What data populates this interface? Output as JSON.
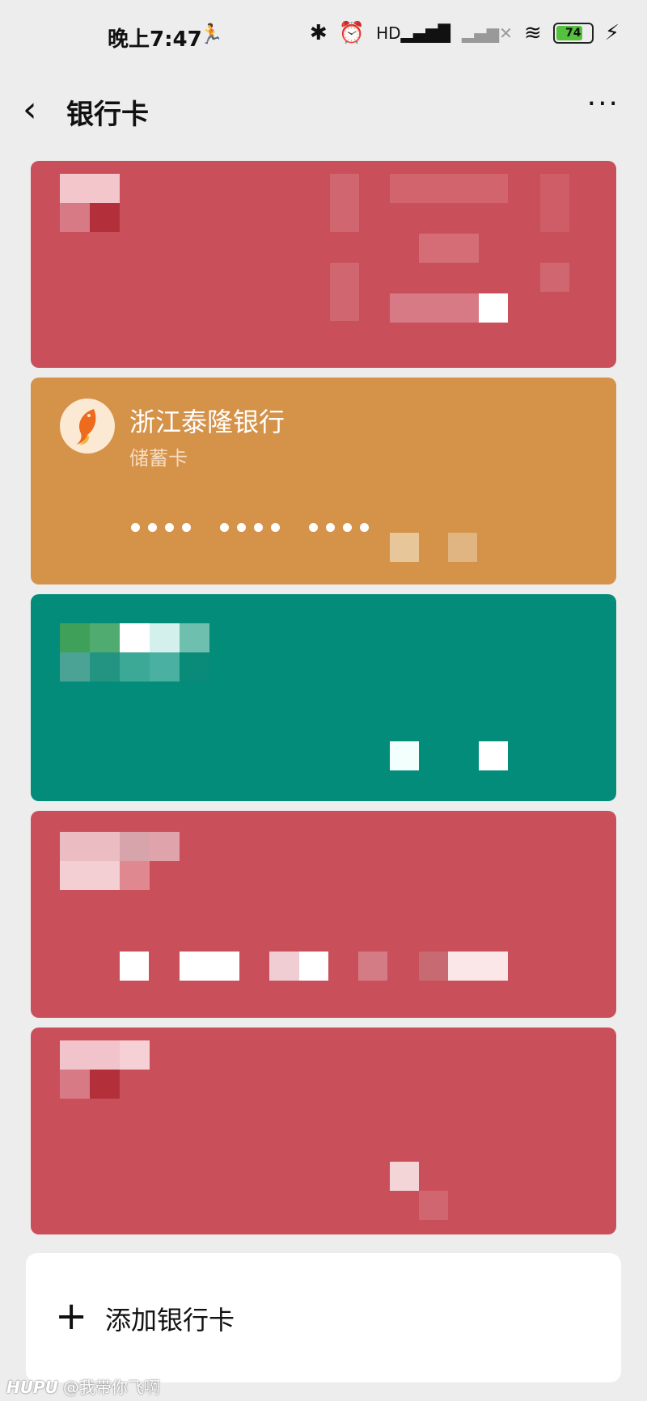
{
  "statusbar": {
    "time": "晚上7:47",
    "battery": "74",
    "icons": [
      "running-icon",
      "bluetooth-icon",
      "alarm-icon",
      "signal-hd-icon",
      "signal-2-icon",
      "wifi-icon",
      "battery-icon",
      "charging-icon"
    ]
  },
  "navbar": {
    "title": "银行卡",
    "more": "···"
  },
  "cards": [
    {
      "color": "#c9505a",
      "obscured": true
    },
    {
      "color": "#d59249",
      "bank_name": "浙江泰隆银行",
      "card_type": "储蓄卡"
    },
    {
      "color": "#028c79",
      "obscured": true
    },
    {
      "color": "#c9505a",
      "obscured": true
    },
    {
      "color": "#c9505a",
      "obscured": true
    }
  ],
  "add": {
    "plus": "+",
    "label": "添加银行卡"
  },
  "watermark": {
    "brand": "HUPU",
    "user": "@我带你飞啊"
  }
}
